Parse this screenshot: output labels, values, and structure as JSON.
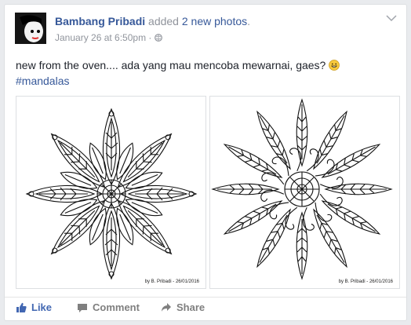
{
  "post": {
    "author": "Bambang Pribadi",
    "action_text": "added",
    "action_link": "2 new photos",
    "action_suffix": ".",
    "timestamp": "January 26 at 6:50pm",
    "separator": "·",
    "privacy_icon": "globe-icon",
    "text": "new from the oven.... ada yang mau mencoba mewarnai, gaes?",
    "emoji": "grinning-face",
    "hashtag": "#mandalas"
  },
  "photos": [
    {
      "credit": "by B. Pribadi - 26/01/2016"
    },
    {
      "credit": "by B. Pribadi - 26/01/2016"
    }
  ],
  "actions": {
    "like": "Like",
    "comment": "Comment",
    "share": "Share"
  },
  "colors": {
    "link": "#365899",
    "like": "#4267b2",
    "muted": "#90949c",
    "action": "#7f7f7f"
  }
}
